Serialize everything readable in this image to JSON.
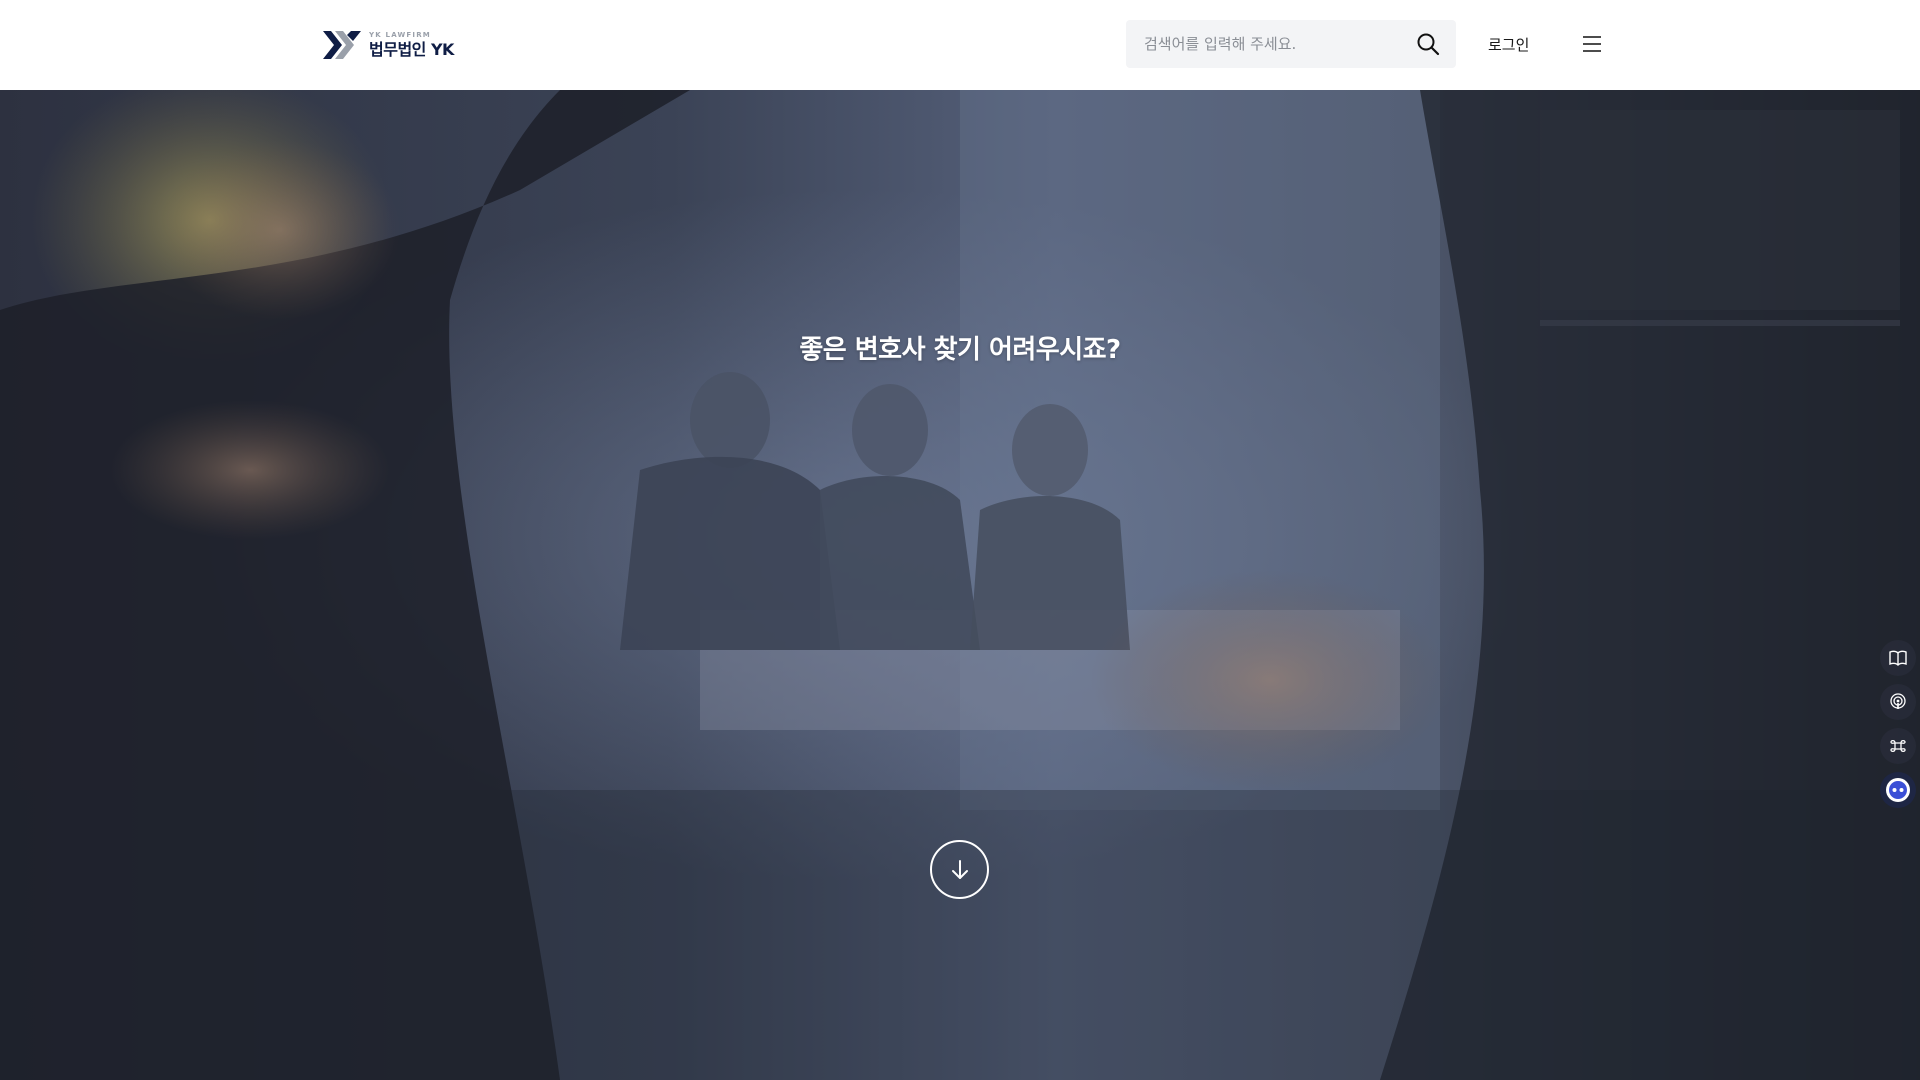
{
  "header": {
    "logo": {
      "small_text": "YK LAWFIRM",
      "main_text": "법무법인 YK"
    },
    "search": {
      "placeholder": "검색어를 입력해 주세요.",
      "value": "",
      "icon": "search-icon"
    },
    "login_label": "로그인",
    "menu_icon": "hamburger-menu-icon"
  },
  "hero": {
    "title": "좋은 변호사 찾기 어려우시죠?",
    "scroll_icon": "arrow-down-icon"
  },
  "quick_menu": [
    {
      "icon": "book-icon"
    },
    {
      "icon": "podcast-icon"
    },
    {
      "icon": "command-icon"
    },
    {
      "icon": "chatbot-icon"
    }
  ],
  "colors": {
    "brand_navy": "#0f1d45",
    "brand_gray": "#9aa0aa",
    "hero_overlay": "#3a4257",
    "search_bg": "#f3f4f6"
  }
}
